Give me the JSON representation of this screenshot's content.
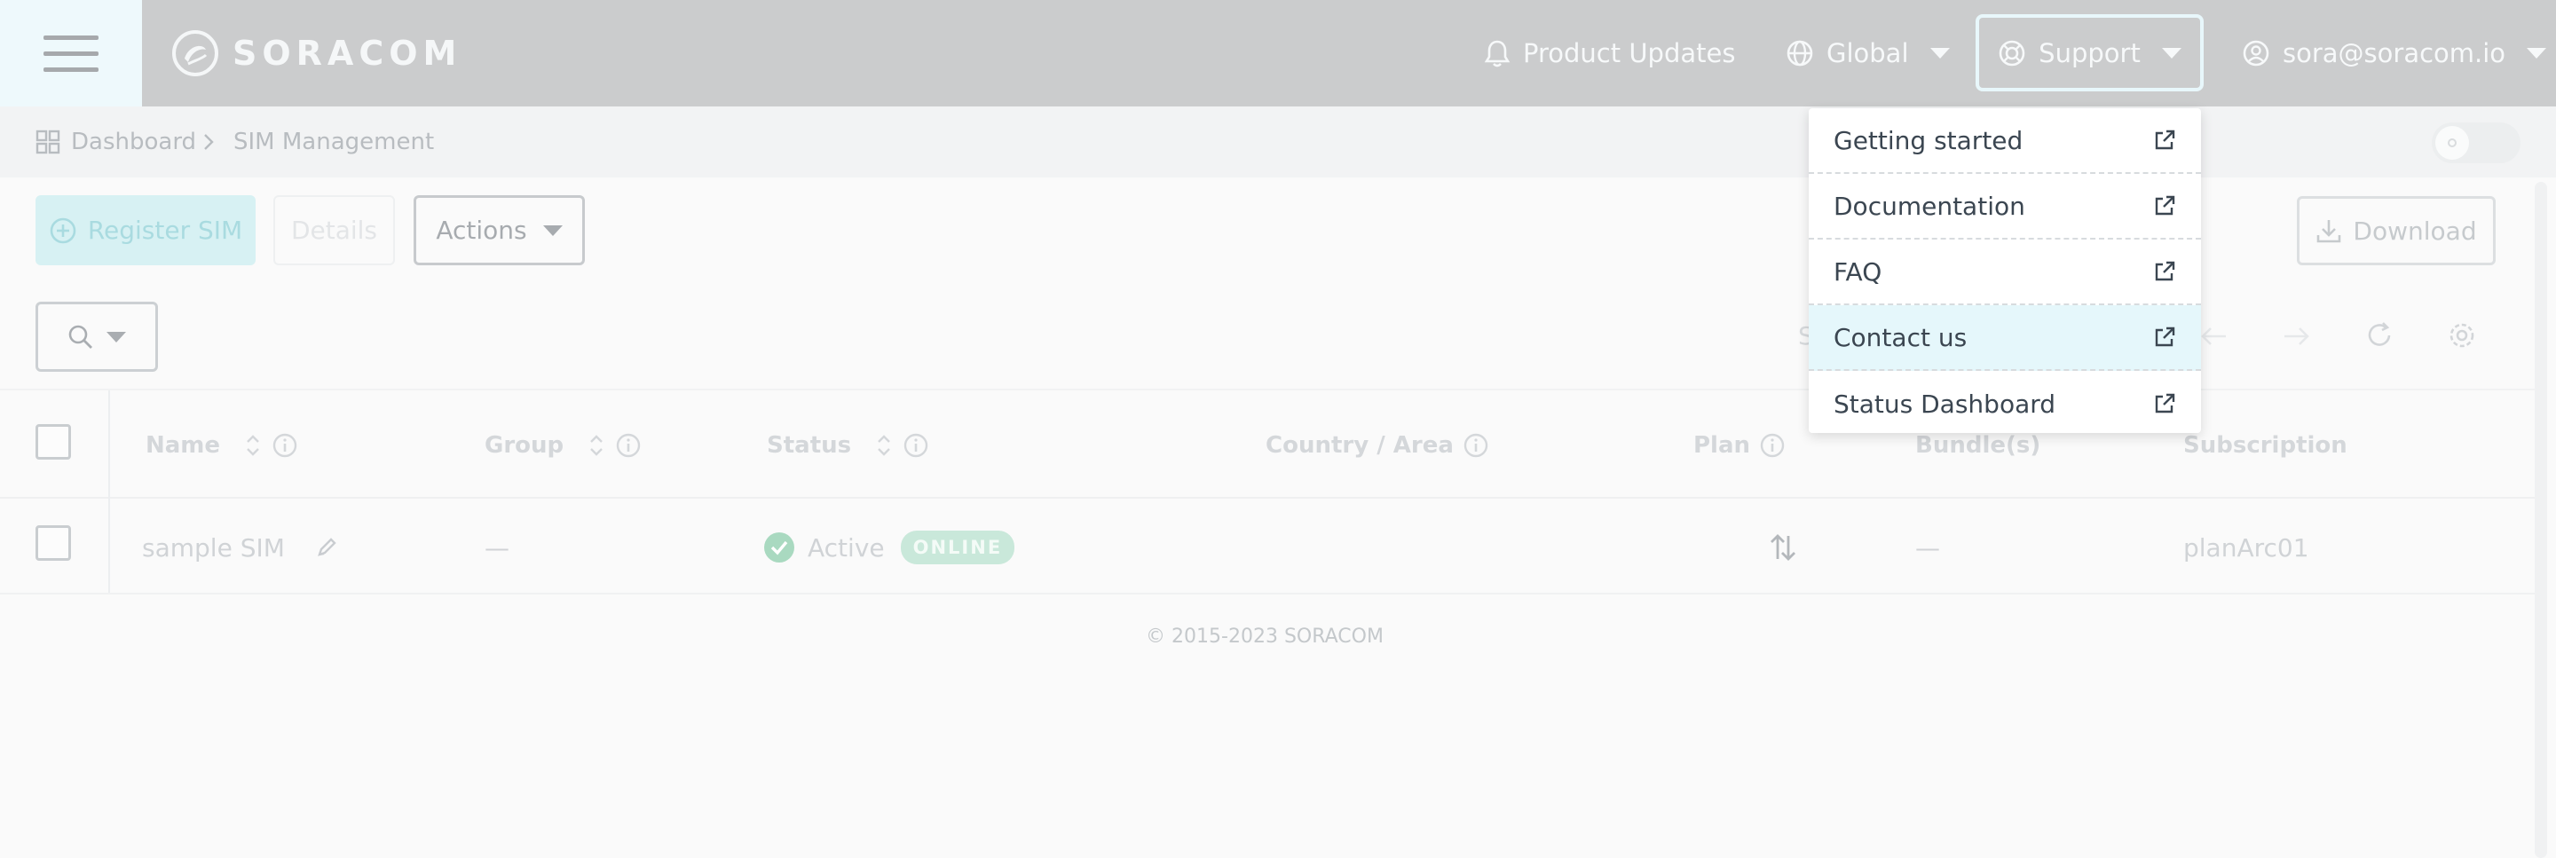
{
  "header": {
    "logo_text": "SORACOM",
    "product_updates": "Product Updates",
    "region": "Global",
    "support": "Support",
    "user_email": "sora@soracom.io"
  },
  "breadcrumb": {
    "home": "Dashboard",
    "current": "SIM Management"
  },
  "toolbar": {
    "register": "Register SIM",
    "details": "Details",
    "actions": "Actions",
    "download": "Download",
    "partial_text": "S"
  },
  "table": {
    "columns": [
      "Name",
      "Group",
      "Status",
      "Country / Area",
      "Plan",
      "Bundle(s)",
      "Subscription"
    ],
    "rows": [
      {
        "name": "sample SIM",
        "group": "—",
        "status": "Active",
        "online_badge": "ONLINE",
        "bundles": "—",
        "subscription": "planArc01"
      }
    ]
  },
  "footer": "© 2015-2023 SORACOM",
  "support_menu": {
    "items": [
      {
        "label": "Getting started"
      },
      {
        "label": "Documentation"
      },
      {
        "label": "FAQ"
      },
      {
        "label": "Contact us"
      },
      {
        "label": "Status Dashboard"
      }
    ],
    "highlighted_index": 3
  },
  "colors": {
    "accent": "#34b8c9",
    "header_overlay": "#cbcccd",
    "menu_highlight": "#e5f7fb"
  }
}
